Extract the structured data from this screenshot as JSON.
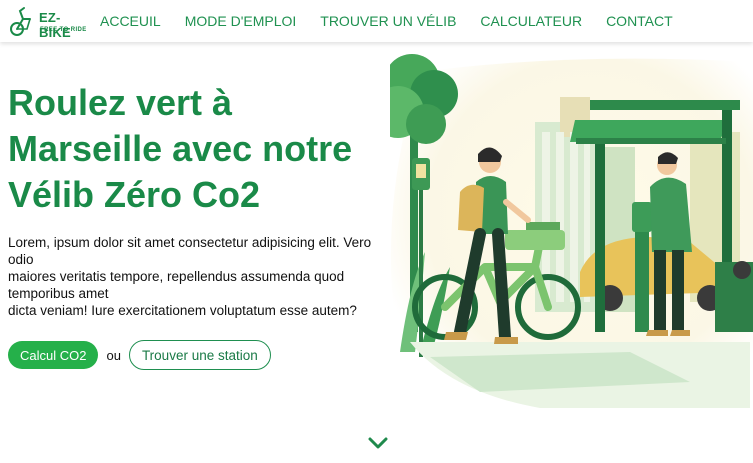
{
  "brand": {
    "name": "EZ-BIKE",
    "tagline": "FREE TO RIDE",
    "logo_icon": "bicycle-logo-icon"
  },
  "nav": {
    "items": [
      {
        "label": "ACCEUIL"
      },
      {
        "label": "MODE D'EMPLOI"
      },
      {
        "label": "TROUVER UN VÉLIB"
      },
      {
        "label": "CALCULATEUR"
      },
      {
        "label": "CONTACT"
      }
    ]
  },
  "hero": {
    "title": "Roulez vert à Marseille avec notre Vélib Zéro Co2",
    "description_lines": [
      "Lorem, ipsum dolor sit amet consectetur adipisicing elit. Vero odio",
      "maiores veritatis tempore, repellendus assumenda quod temporibus amet",
      "dicta veniam! Iure exercitationem voluptatum esse autem?"
    ],
    "primary_button": "Calcul CO2",
    "separator": "ou",
    "secondary_button": "Trouver une station",
    "illustration_icon": "bike-station-illustration",
    "scroll_icon": "chevron-down-icon"
  },
  "colors": {
    "brand_green": "#1a8a48",
    "nav_green": "#1f9150",
    "button_green": "#25b04a",
    "illustration_bg": "#fbf8ea"
  }
}
